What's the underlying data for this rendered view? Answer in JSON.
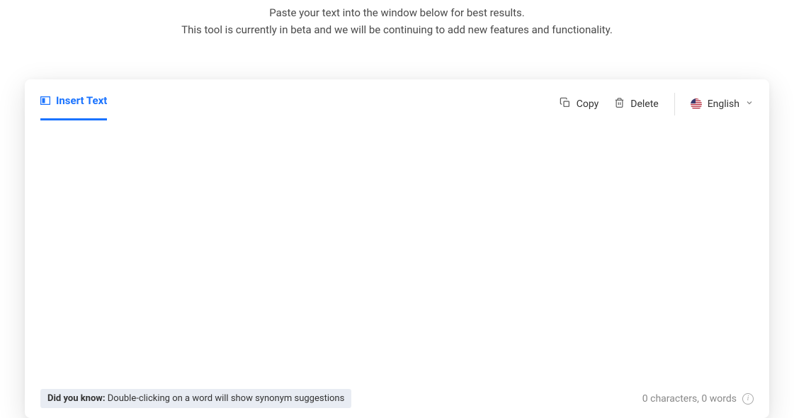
{
  "intro": {
    "line1": "Paste your text into the window below for best results.",
    "line2": "This tool is currently in beta and we will be continuing to add new features and functionality."
  },
  "tab": {
    "label": "Insert Text"
  },
  "actions": {
    "copy": "Copy",
    "delete": "Delete"
  },
  "language": {
    "selected": "English"
  },
  "tip": {
    "prefix": "Did you know:",
    "text": " Double-clicking on a word will show synonym suggestions"
  },
  "stats": {
    "text": "0 characters, 0 words"
  }
}
